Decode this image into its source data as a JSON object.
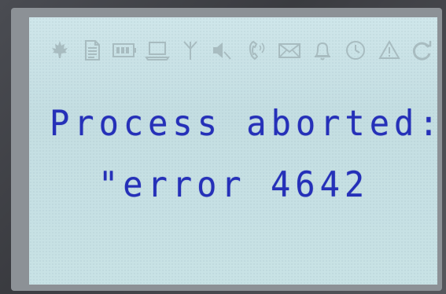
{
  "status_bar": {
    "icons": [
      "maple-leaf-icon",
      "document-icon",
      "battery-icon",
      "laptop-icon",
      "antenna-icon",
      "speaker-muted-icon",
      "phone-icon",
      "envelope-icon",
      "bell-icon",
      "clock-icon",
      "warning-icon",
      "refresh-icon"
    ]
  },
  "message": {
    "line1": "Process aborted:",
    "line2": "\"error 4642"
  },
  "colors": {
    "screen_background": "#c8e2e5",
    "text": "#2530b8",
    "icon_inactive": "#a8bcc0",
    "bezel": "#8c9196"
  }
}
